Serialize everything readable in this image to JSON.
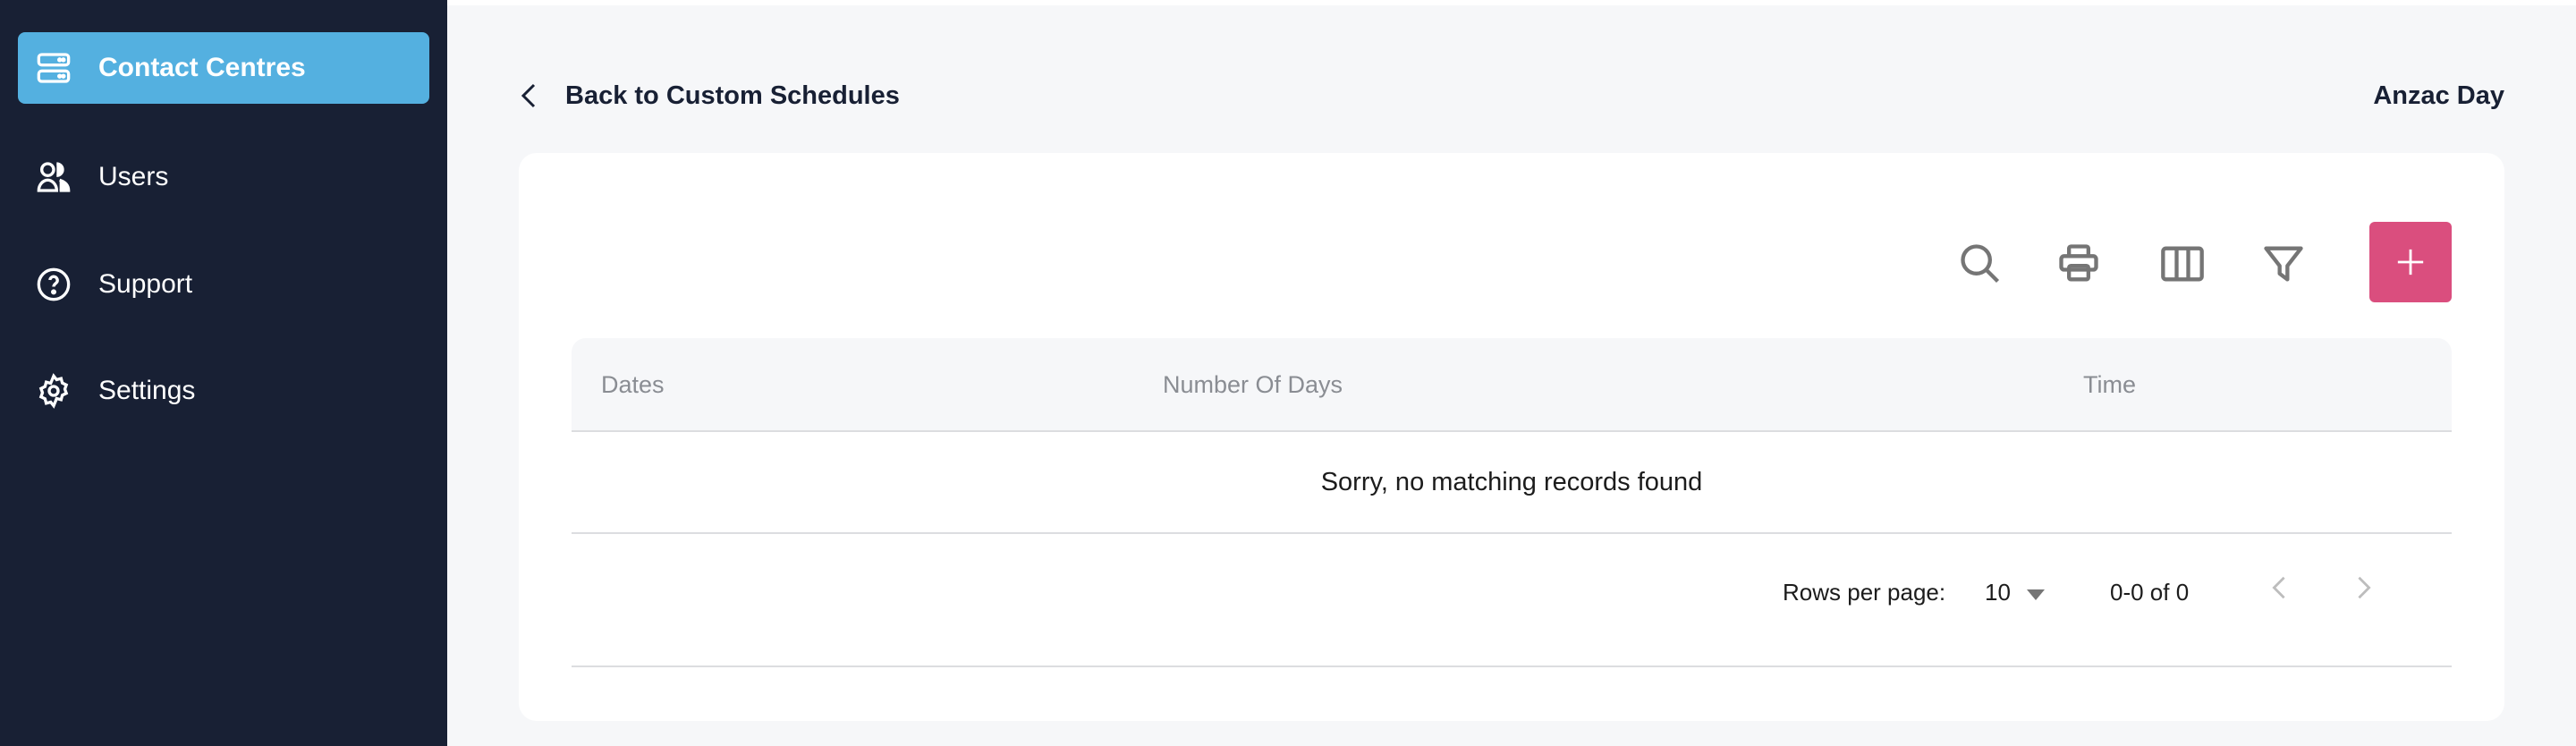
{
  "sidebar": {
    "items": [
      {
        "label": "Contact Centres",
        "icon": "server-icon",
        "active": true
      },
      {
        "label": "Users",
        "icon": "users-icon",
        "active": false
      },
      {
        "label": "Support",
        "icon": "help-circle-icon",
        "active": false
      },
      {
        "label": "Settings",
        "icon": "gear-icon",
        "active": false
      }
    ]
  },
  "header": {
    "back_label": "Back to Custom Schedules",
    "title": "Anzac Day"
  },
  "toolbar": {
    "icons": [
      "search-icon",
      "print-icon",
      "view-columns-icon",
      "filter-icon",
      "plus-icon"
    ]
  },
  "table": {
    "columns": [
      "Dates",
      "Number Of Days",
      "Time"
    ],
    "empty_message": "Sorry, no matching records found"
  },
  "pagination": {
    "rows_per_page_label": "Rows per page:",
    "rows_per_page": "10",
    "range": "0-0 of 0"
  },
  "colors": {
    "sidebar": "#182034",
    "active": "#54b0e0",
    "accent": "#da4e7e"
  }
}
